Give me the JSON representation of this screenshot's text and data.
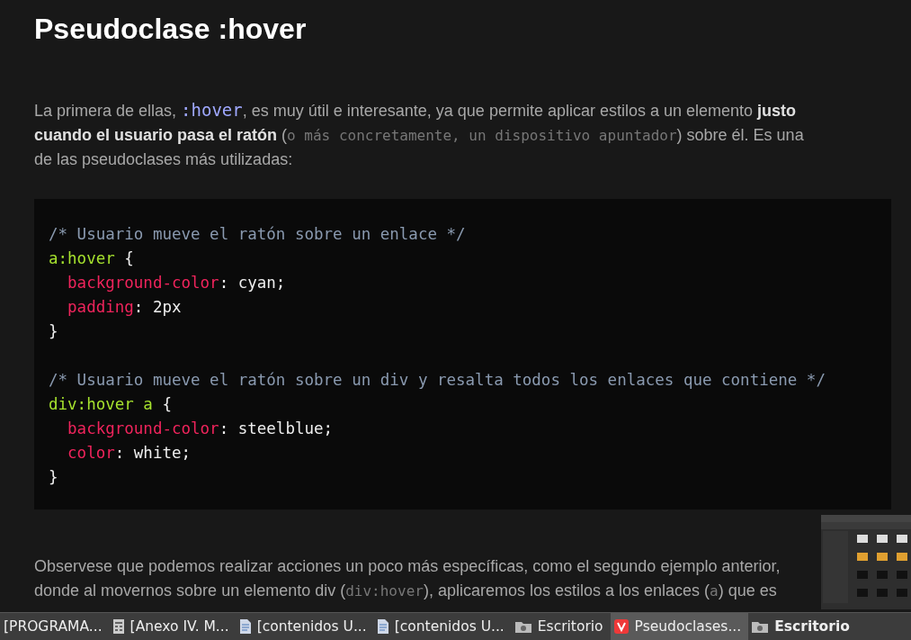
{
  "heading": "Pseudoclase :hover",
  "intro": [
    {
      "kind": "text",
      "text": "La primera de ellas, "
    },
    {
      "kind": "code",
      "text": ":hover"
    },
    {
      "kind": "text",
      "text": ", es muy útil e interesante, ya que permite aplicar estilos a un elemento "
    },
    {
      "kind": "bold",
      "text": "justo cuando el usuario pasa el ratón"
    },
    {
      "kind": "text",
      "text": " ("
    },
    {
      "kind": "note",
      "text": "o más concretamente, un dispositivo apuntador"
    },
    {
      "kind": "text",
      "text": ") sobre él. Es una de las pseudoclases más utilizadas:"
    }
  ],
  "code_lines": [
    {
      "kind": "code",
      "tokens": [
        {
          "kind": "comment",
          "text": "/* Usuario mueve el ratón sobre un enlace */"
        }
      ]
    },
    {
      "kind": "code",
      "tokens": [
        {
          "kind": "selector",
          "text": "a:hover"
        },
        {
          "kind": "plain",
          "text": " {"
        }
      ]
    },
    {
      "kind": "code",
      "indent": true,
      "tokens": [
        {
          "kind": "property",
          "text": "background-color"
        },
        {
          "kind": "plain",
          "text": ": cyan;"
        }
      ]
    },
    {
      "kind": "code",
      "indent": true,
      "tokens": [
        {
          "kind": "property",
          "text": "padding"
        },
        {
          "kind": "plain",
          "text": ": 2px"
        }
      ]
    },
    {
      "kind": "code",
      "tokens": [
        {
          "kind": "plain",
          "text": "}"
        }
      ]
    },
    {
      "kind": "blank"
    },
    {
      "kind": "code",
      "tokens": [
        {
          "kind": "comment",
          "text": "/* Usuario mueve el ratón sobre un div y resalta todos los enlaces que contiene */"
        }
      ]
    },
    {
      "kind": "code",
      "tokens": [
        {
          "kind": "selector",
          "text": "div:hover a"
        },
        {
          "kind": "plain",
          "text": " {"
        }
      ]
    },
    {
      "kind": "code",
      "indent": true,
      "tokens": [
        {
          "kind": "property",
          "text": "background-color"
        },
        {
          "kind": "plain",
          "text": ": steelblue;"
        }
      ]
    },
    {
      "kind": "code",
      "indent": true,
      "tokens": [
        {
          "kind": "property",
          "text": "color"
        },
        {
          "kind": "plain",
          "text": ": white;"
        }
      ]
    },
    {
      "kind": "code",
      "tokens": [
        {
          "kind": "plain",
          "text": "}"
        }
      ]
    }
  ],
  "outro": [
    {
      "kind": "text",
      "text": "Observese que podemos realizar acciones un poco más específicas, como el segundo ejemplo anterior, donde al movernos sobre un elemento div ("
    },
    {
      "kind": "note",
      "text": "div:hover"
    },
    {
      "kind": "text",
      "text": "), aplicaremos los estilos a los enlaces ("
    },
    {
      "kind": "note",
      "text": "a"
    },
    {
      "kind": "text",
      "text": ") que es"
    }
  ],
  "taskbar": [
    {
      "kind": "plain",
      "label": "[PROGRAMA...",
      "selected": false
    },
    {
      "kind": "calc",
      "label": "[Anexo IV. M...",
      "selected": false
    },
    {
      "kind": "doc",
      "label": "[contenidos U...",
      "selected": false
    },
    {
      "kind": "doc",
      "label": "[contenidos U...",
      "selected": false
    },
    {
      "kind": "folder",
      "label": "Escritorio",
      "selected": false
    },
    {
      "kind": "browser",
      "label": "Pseudoclases...",
      "selected": true
    },
    {
      "kind": "folder",
      "label": "Escritorio",
      "selected": false
    }
  ]
}
